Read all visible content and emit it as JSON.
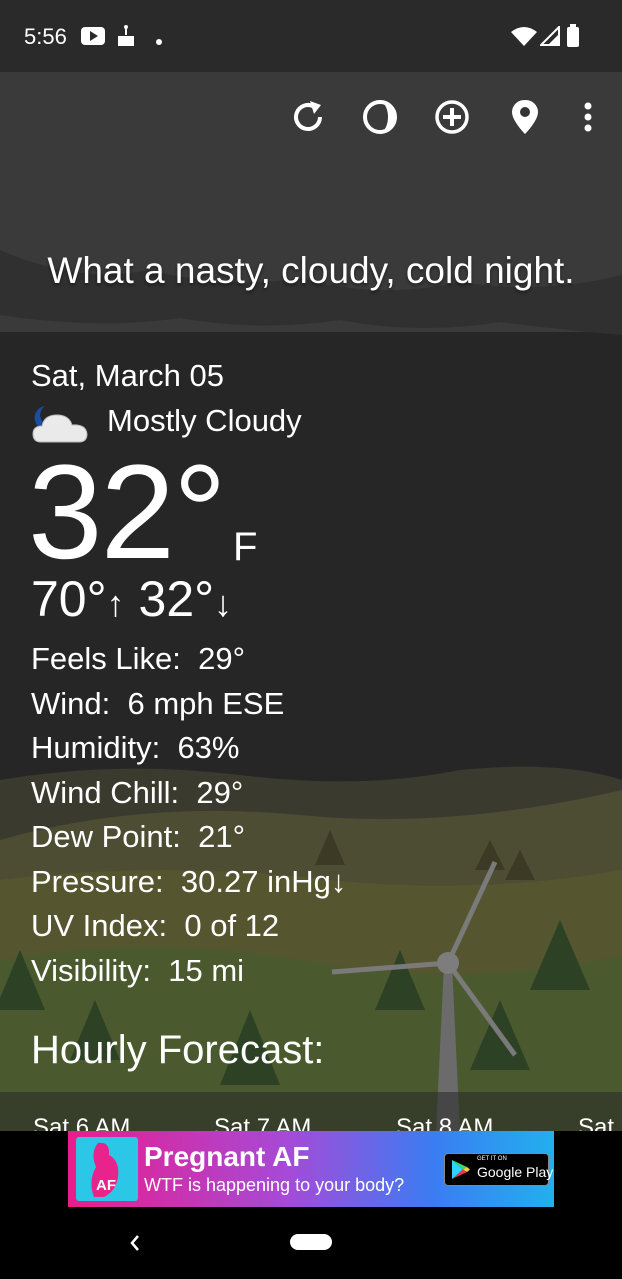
{
  "status_bar": {
    "time": "5:56",
    "icons": [
      "youtube-icon",
      "cake-icon",
      "dot-icon",
      "wifi-icon",
      "cell-signal-icon",
      "battery-icon"
    ]
  },
  "toolbar": {
    "buttons": [
      "refresh-icon",
      "theme-icon",
      "add-location-icon",
      "location-pin-icon",
      "more-options-icon"
    ]
  },
  "headline": "What a nasty, cloudy, cold night.",
  "current": {
    "date": "Sat, March 05",
    "condition": "Mostly Cloudy",
    "condition_icon": "moon-cloud-icon",
    "temperature": "32°",
    "unit": "F",
    "high": "70°",
    "low": "32°"
  },
  "details": [
    {
      "label": "Feels Like:",
      "value": "29°"
    },
    {
      "label": "Wind:",
      "value": "6 mph ESE"
    },
    {
      "label": "Humidity:",
      "value": "63%"
    },
    {
      "label": "Wind Chill:",
      "value": "29°"
    },
    {
      "label": "Dew Point:",
      "value": "21°"
    },
    {
      "label": "Pressure:",
      "value": "30.27 inHg↓"
    },
    {
      "label": "UV Index:",
      "value": "0 of 12"
    },
    {
      "label": "Visibility:",
      "value": "15 mi"
    }
  ],
  "hourly": {
    "title": "Hourly Forecast:",
    "hours": [
      "Sat 6 AM",
      "Sat 7 AM",
      "Sat 8 AM",
      "Sat"
    ]
  },
  "ad": {
    "title": "Pregnant AF",
    "subtitle": "WTF is happening to your body?",
    "badge_small": "GET IT ON",
    "badge_big": "Google Play",
    "logo_text": "AF"
  },
  "colors": {
    "background": "#262626",
    "status_bar": "#2a2a2a",
    "text": "#ffffff"
  }
}
